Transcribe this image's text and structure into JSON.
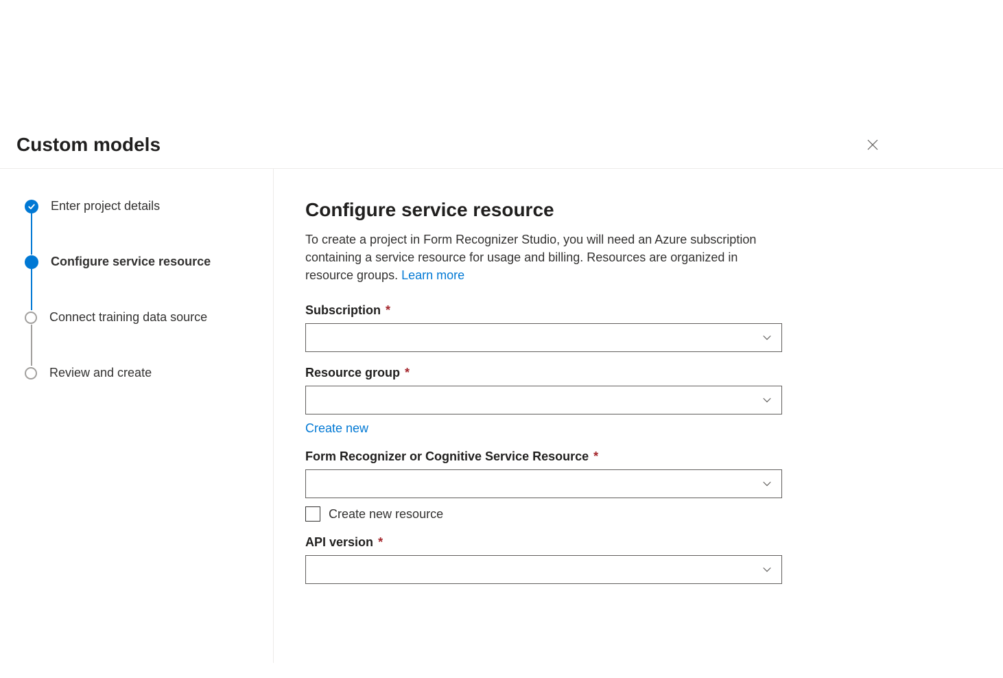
{
  "header": {
    "title": "Custom models"
  },
  "steps": [
    {
      "label": "Enter project details",
      "state": "completed"
    },
    {
      "label": "Configure service resource",
      "state": "current"
    },
    {
      "label": "Connect training data source",
      "state": "pending"
    },
    {
      "label": "Review and create",
      "state": "pending"
    }
  ],
  "main": {
    "heading": "Configure service resource",
    "description_pre": "To create a project in Form Recognizer Studio, you will need an Azure subscription containing a service resource for usage and billing. Resources are organized in resource groups. ",
    "learn_more": "Learn more"
  },
  "fields": {
    "subscription": {
      "label": "Subscription",
      "required": "*",
      "value": ""
    },
    "resource_group": {
      "label": "Resource group",
      "required": "*",
      "value": "",
      "create_new": "Create new"
    },
    "service_resource": {
      "label": "Form Recognizer or Cognitive Service Resource",
      "required": "*",
      "value": "",
      "create_new_checkbox": "Create new resource"
    },
    "api_version": {
      "label": "API version",
      "required": "*",
      "value": ""
    }
  }
}
